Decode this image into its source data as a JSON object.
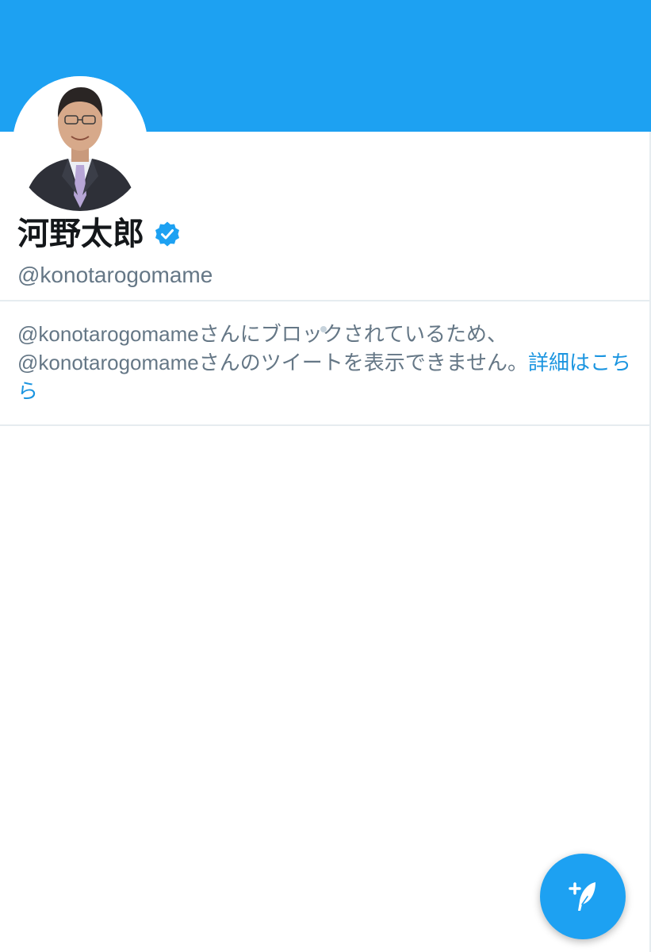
{
  "profile": {
    "display_name": "河野太郎",
    "handle": "@konotarogomame",
    "verified": true
  },
  "blocked_notice": {
    "line1": "@konotarogomameさんにブロックされているため、",
    "line2": "@konotarogomameさんのツイートを表示できません。",
    "link_text": "詳細はこちら"
  },
  "icons": {
    "verified": "verified-badge-icon",
    "compose": "compose-tweet-icon"
  },
  "colors": {
    "banner": "#1da1f2",
    "link": "#1b95e0",
    "secondary_text": "#657786",
    "primary_text": "#14171a",
    "fab": "#1da1f2"
  }
}
